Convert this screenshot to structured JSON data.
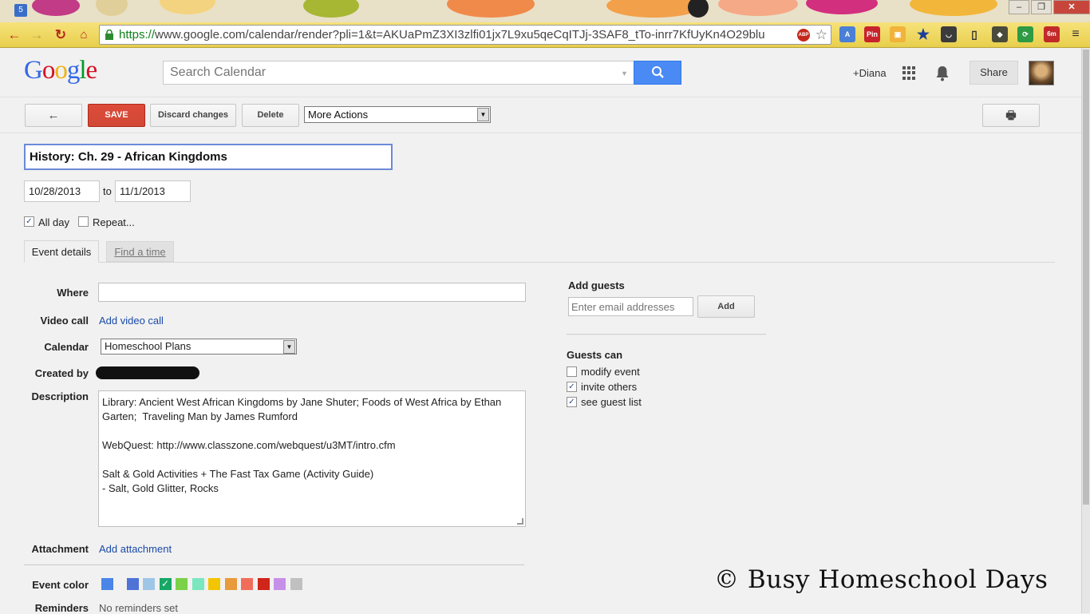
{
  "browser": {
    "url_scheme": "https://",
    "url_rest": "www.google.com/calendar/render?pli=1&t=AKUaPmZ3XI3zlfi01jx7L9xu5qeCqITJj-3SAF8_tTo-inrr7KfUyKn4O29blu",
    "tab_badge": "5",
    "ext_pin": "Pin",
    "ext_timer": "6m",
    "win_min": "–",
    "win_max": "❐",
    "win_close": "✕",
    "abp": "ABP"
  },
  "header": {
    "logo_letters": [
      "G",
      "o",
      "o",
      "g",
      "l",
      "e"
    ],
    "logo_colors": [
      "#3369e8",
      "#d50f25",
      "#eeb211",
      "#3369e8",
      "#009925",
      "#d50f25"
    ],
    "search_placeholder": "Search Calendar",
    "user": "+Diana",
    "share": "Share"
  },
  "actions": {
    "back": "←",
    "save": "SAVE",
    "discard": "Discard changes",
    "delete": "Delete",
    "more_actions": "More Actions",
    "print": "🖶"
  },
  "event": {
    "title": "History: Ch. 29 - African Kingdoms",
    "start_date": "10/28/2013",
    "to": "to",
    "end_date": "11/1/2013",
    "all_day_label": "All day",
    "all_day_checked": true,
    "repeat_label": "Repeat...",
    "repeat_checked": false
  },
  "tabs": {
    "event_details": "Event details",
    "find_time": "Find a time"
  },
  "details": {
    "where_label": "Where",
    "where_value": "",
    "video_label": "Video call",
    "video_link": "Add video call",
    "calendar_label": "Calendar",
    "calendar_value": "Homeschool Plans",
    "created_label": "Created by",
    "description_label": "Description",
    "description": "Library: Ancient West African Kingdoms by Jane Shuter; Foods of West Africa by Ethan Garten;  Traveling Man by James Rumford\n\nWebQuest: http://www.classzone.com/webquest/u3MT/intro.cfm\n\nSalt & Gold Activities + The Fast Tax Game (Activity Guide)\n- Salt, Gold Glitter, Rocks",
    "attachment_label": "Attachment",
    "attachment_link": "Add attachment",
    "color_label": "Event color",
    "event_colors": [
      "#4986e7",
      "#4f73d7",
      "#9fc6e7",
      "#16a765",
      "#7bd148",
      "#7ae7bf",
      "#f3c400",
      "#e89a3c",
      "#f16d5a",
      "#d0251a",
      "#c790e8",
      "#c0c0c0"
    ],
    "reminders_label": "Reminders",
    "reminders_value": "No reminders set"
  },
  "guests": {
    "title": "Add guests",
    "placeholder": "Enter email addresses",
    "add": "Add",
    "can_title": "Guests can",
    "options": [
      {
        "label": "modify event",
        "checked": false
      },
      {
        "label": "invite others",
        "checked": true
      },
      {
        "label": "see guest list",
        "checked": true
      }
    ]
  },
  "watermark": "© Busy Homeschool Days"
}
